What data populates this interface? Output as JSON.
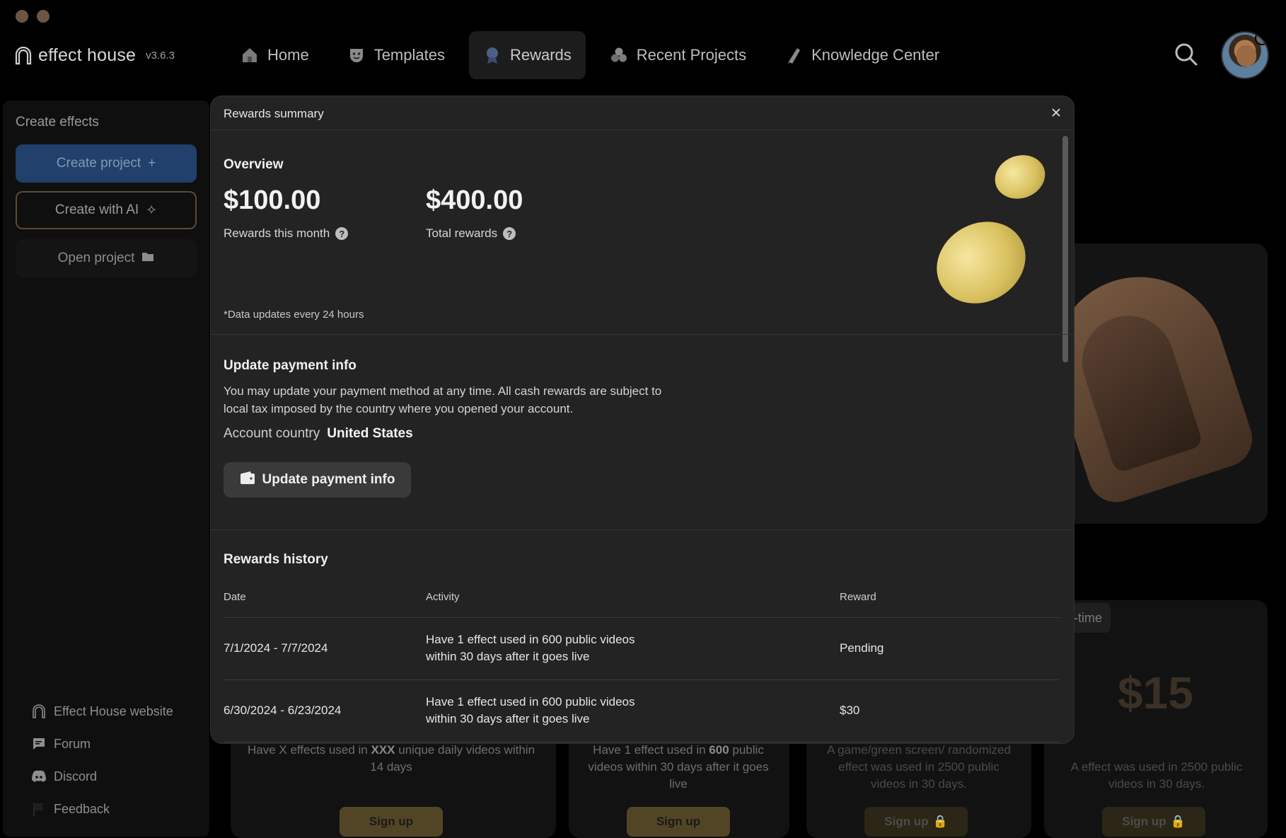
{
  "app": {
    "brand": "effect house",
    "version": "v3.6.3"
  },
  "nav": {
    "items": [
      {
        "label": "Home",
        "icon": "home-icon"
      },
      {
        "label": "Templates",
        "icon": "templates-icon"
      },
      {
        "label": "Rewards",
        "icon": "rewards-icon",
        "active": true
      },
      {
        "label": "Recent Projects",
        "icon": "recent-projects-icon"
      },
      {
        "label": "Knowledge Center",
        "icon": "knowledge-center-icon"
      }
    ]
  },
  "sidebar": {
    "title": "Create effects",
    "create_project": "Create project",
    "create_ai": "Create with AI",
    "open_project": "Open project",
    "links": [
      {
        "label": "Effect House website",
        "icon": "house-icon"
      },
      {
        "label": "Forum",
        "icon": "forum-icon"
      },
      {
        "label": "Discord",
        "icon": "discord-icon"
      },
      {
        "label": "Feedback",
        "icon": "flag-icon"
      }
    ]
  },
  "background": {
    "tag": "e-time",
    "price": "$15",
    "cards": [
      {
        "text_a": "Have X effects used in ",
        "bold": "XXX",
        "text_b": " unique daily videos within 14 days",
        "signup": "Sign up",
        "locked": false
      },
      {
        "text_a": "Have 1 effect used in ",
        "bold": "600",
        "text_b": " public videos within 30 days after it goes live",
        "signup": "Sign up",
        "locked": false
      },
      {
        "text_a": "A game/green screen/ randomized effect was used in 2500 public videos in 30 days.",
        "bold": "",
        "text_b": "",
        "signup": "Sign up",
        "locked": true
      },
      {
        "text_a": "A effect was used in 2500 public videos in 30 days.",
        "bold": "",
        "text_b": "",
        "signup": "Sign up",
        "locked": true
      }
    ]
  },
  "modal": {
    "title": "Rewards summary",
    "overview": {
      "heading": "Overview",
      "month_value": "$100.00",
      "month_label": "Rewards this month",
      "total_value": "$400.00",
      "total_label": "Total rewards",
      "note": "*Data updates every 24 hours"
    },
    "payment": {
      "heading": "Update payment info",
      "description_1": "You may update your payment method at any time. All cash rewards are subject to",
      "description_2": "local tax imposed by the country where you opened your account.",
      "country_label": "Account country",
      "country_value": "United States",
      "button": "Update payment info"
    },
    "history": {
      "heading": "Rewards history",
      "columns": [
        "Date",
        "Activity",
        "Reward"
      ],
      "rows": [
        {
          "date": "7/1/2024 - 7/7/2024",
          "activity_1": "Have 1 effect used in 600 public videos",
          "activity_2": "within 30 days after it goes live",
          "reward": "Pending"
        },
        {
          "date": "6/30/2024 - 6/23/2024",
          "activity_1": "Have 1 effect used in 600 public videos",
          "activity_2": "within 30 days after it goes live",
          "reward": "$30"
        }
      ]
    }
  },
  "colors": {
    "accent_blue": "#21406b",
    "gold": "#d9c15f"
  }
}
